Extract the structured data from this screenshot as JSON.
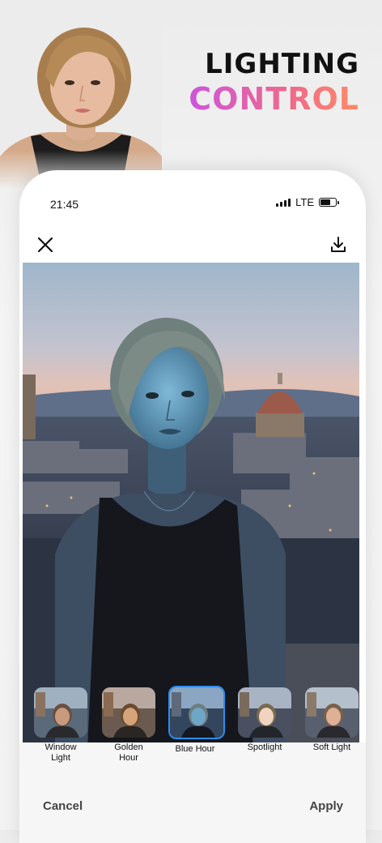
{
  "headline": {
    "line1": "LIGHTING",
    "line2": "CONTROL"
  },
  "status": {
    "time": "21:45",
    "network": "LTE"
  },
  "toolbar": {
    "close_icon": "close-icon",
    "download_icon": "download-icon"
  },
  "presets": [
    {
      "label_line1": "Window",
      "label_line2": "Light",
      "selected": false
    },
    {
      "label_line1": "Golden",
      "label_line2": "Hour",
      "selected": false
    },
    {
      "label_line1": "Blue Hour",
      "label_line2": "",
      "selected": true
    },
    {
      "label_line1": "Spotlight",
      "label_line2": "",
      "selected": false
    },
    {
      "label_line1": "Soft Light",
      "label_line2": "",
      "selected": false
    }
  ],
  "actions": {
    "cancel_label": "Cancel",
    "apply_label": "Apply"
  },
  "colors": {
    "accent": "#2d8df0",
    "gradient_start": "#cc55dd",
    "gradient_end": "#ff8a66"
  }
}
